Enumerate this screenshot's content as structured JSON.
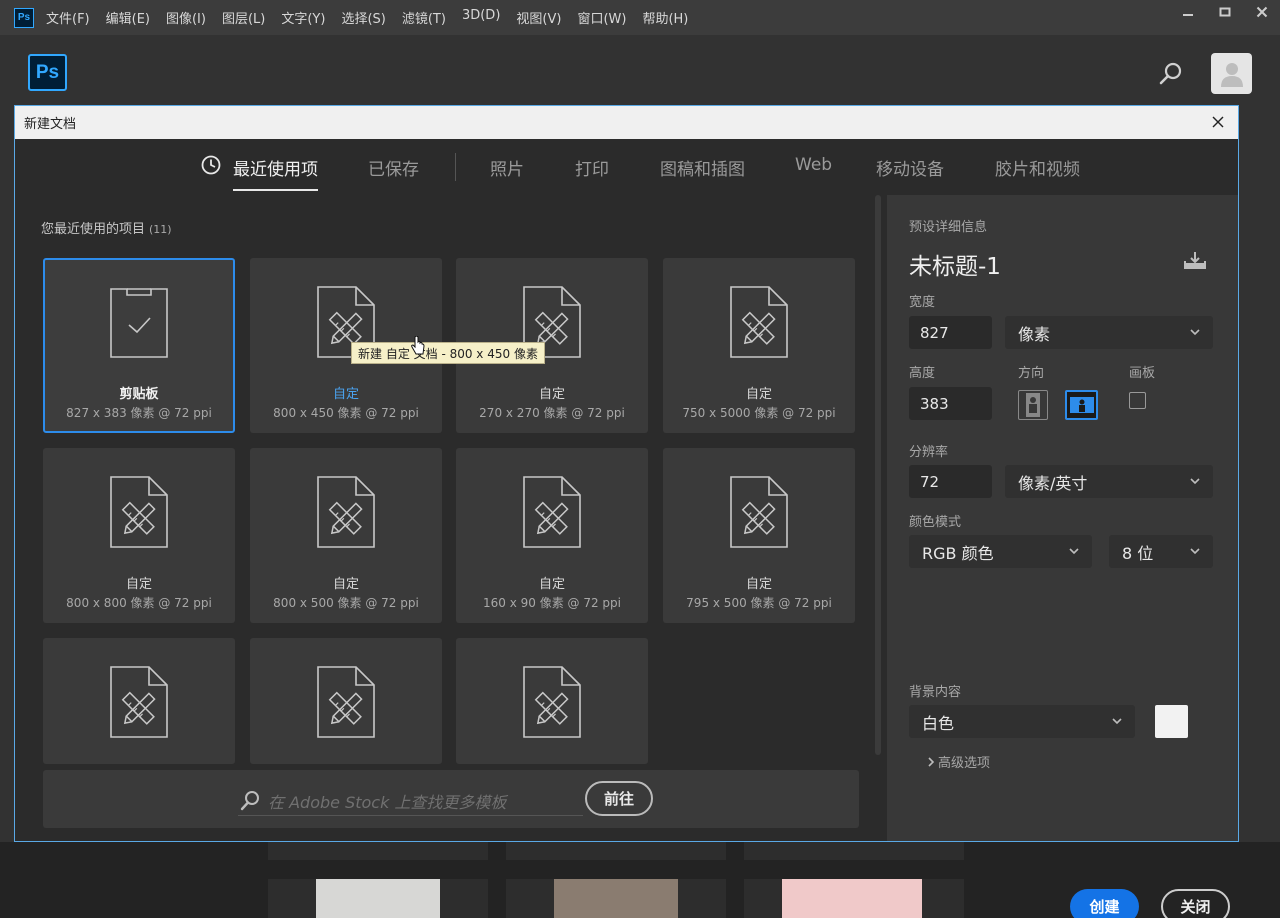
{
  "menubar": {
    "app_icon_label": "Ps",
    "items": [
      "文件(F)",
      "编辑(E)",
      "图像(I)",
      "图层(L)",
      "文字(Y)",
      "选择(S)",
      "滤镜(T)",
      "3D(D)",
      "视图(V)",
      "窗口(W)",
      "帮助(H)"
    ]
  },
  "header": {
    "logo": "Ps"
  },
  "dialog": {
    "title": "新建文档",
    "tabs": [
      "最近使用项",
      "已保存",
      "照片",
      "打印",
      "图稿和插图",
      "Web",
      "移动设备",
      "胶片和视频"
    ],
    "active_tab": "最近使用项",
    "recent_title": "您最近使用的项目",
    "recent_count": "(11)",
    "presets": [
      {
        "name": "剪贴板",
        "dims": "827 x 383 像素 @ 72 ppi",
        "icon": "clipboard-icon"
      },
      {
        "name": "自定",
        "dims": "800 x 450 像素 @ 72 ppi",
        "icon": "document-pencil-ruler-icon"
      },
      {
        "name": "自定",
        "dims": "270 x 270 像素 @ 72 ppi",
        "icon": "document-pencil-ruler-icon"
      },
      {
        "name": "自定",
        "dims": "750 x 5000 像素 @ 72 ppi",
        "icon": "document-pencil-ruler-icon"
      },
      {
        "name": "自定",
        "dims": "800 x 800 像素 @ 72 ppi",
        "icon": "document-pencil-ruler-icon"
      },
      {
        "name": "自定",
        "dims": "800 x 500 像素 @ 72 ppi",
        "icon": "document-pencil-ruler-icon"
      },
      {
        "name": "自定",
        "dims": "160 x 90 像素 @ 72 ppi",
        "icon": "document-pencil-ruler-icon"
      },
      {
        "name": "自定",
        "dims": "795 x 500 像素 @ 72 ppi",
        "icon": "document-pencil-ruler-icon"
      },
      {
        "name": "",
        "dims": "",
        "icon": "document-pencil-ruler-icon"
      },
      {
        "name": "",
        "dims": "",
        "icon": "document-pencil-ruler-icon"
      },
      {
        "name": "",
        "dims": "",
        "icon": "document-pencil-ruler-icon"
      }
    ],
    "tooltip": "新建 自定 文档 - 800 x 450 像素",
    "stock": {
      "placeholder": "在 Adobe Stock 上查找更多模板",
      "go_label": "前往"
    },
    "details": {
      "section_label": "预设详细信息",
      "doc_name": "未标题-1",
      "width_label": "宽度",
      "width_value": "827",
      "width_unit": "像素",
      "height_label": "高度",
      "height_value": "383",
      "orientation_label": "方向",
      "artboard_label": "画板",
      "resolution_label": "分辨率",
      "resolution_value": "72",
      "resolution_unit": "像素/英寸",
      "color_mode_label": "颜色模式",
      "color_mode": "RGB 颜色",
      "bit_depth": "8 位",
      "background_label": "背景内容",
      "background": "白色",
      "advanced_label": "高级选项",
      "create_label": "创建",
      "close_label": "关闭"
    }
  },
  "colors": {
    "accent": "#1473e6",
    "selected_border": "#2d8ceb"
  }
}
